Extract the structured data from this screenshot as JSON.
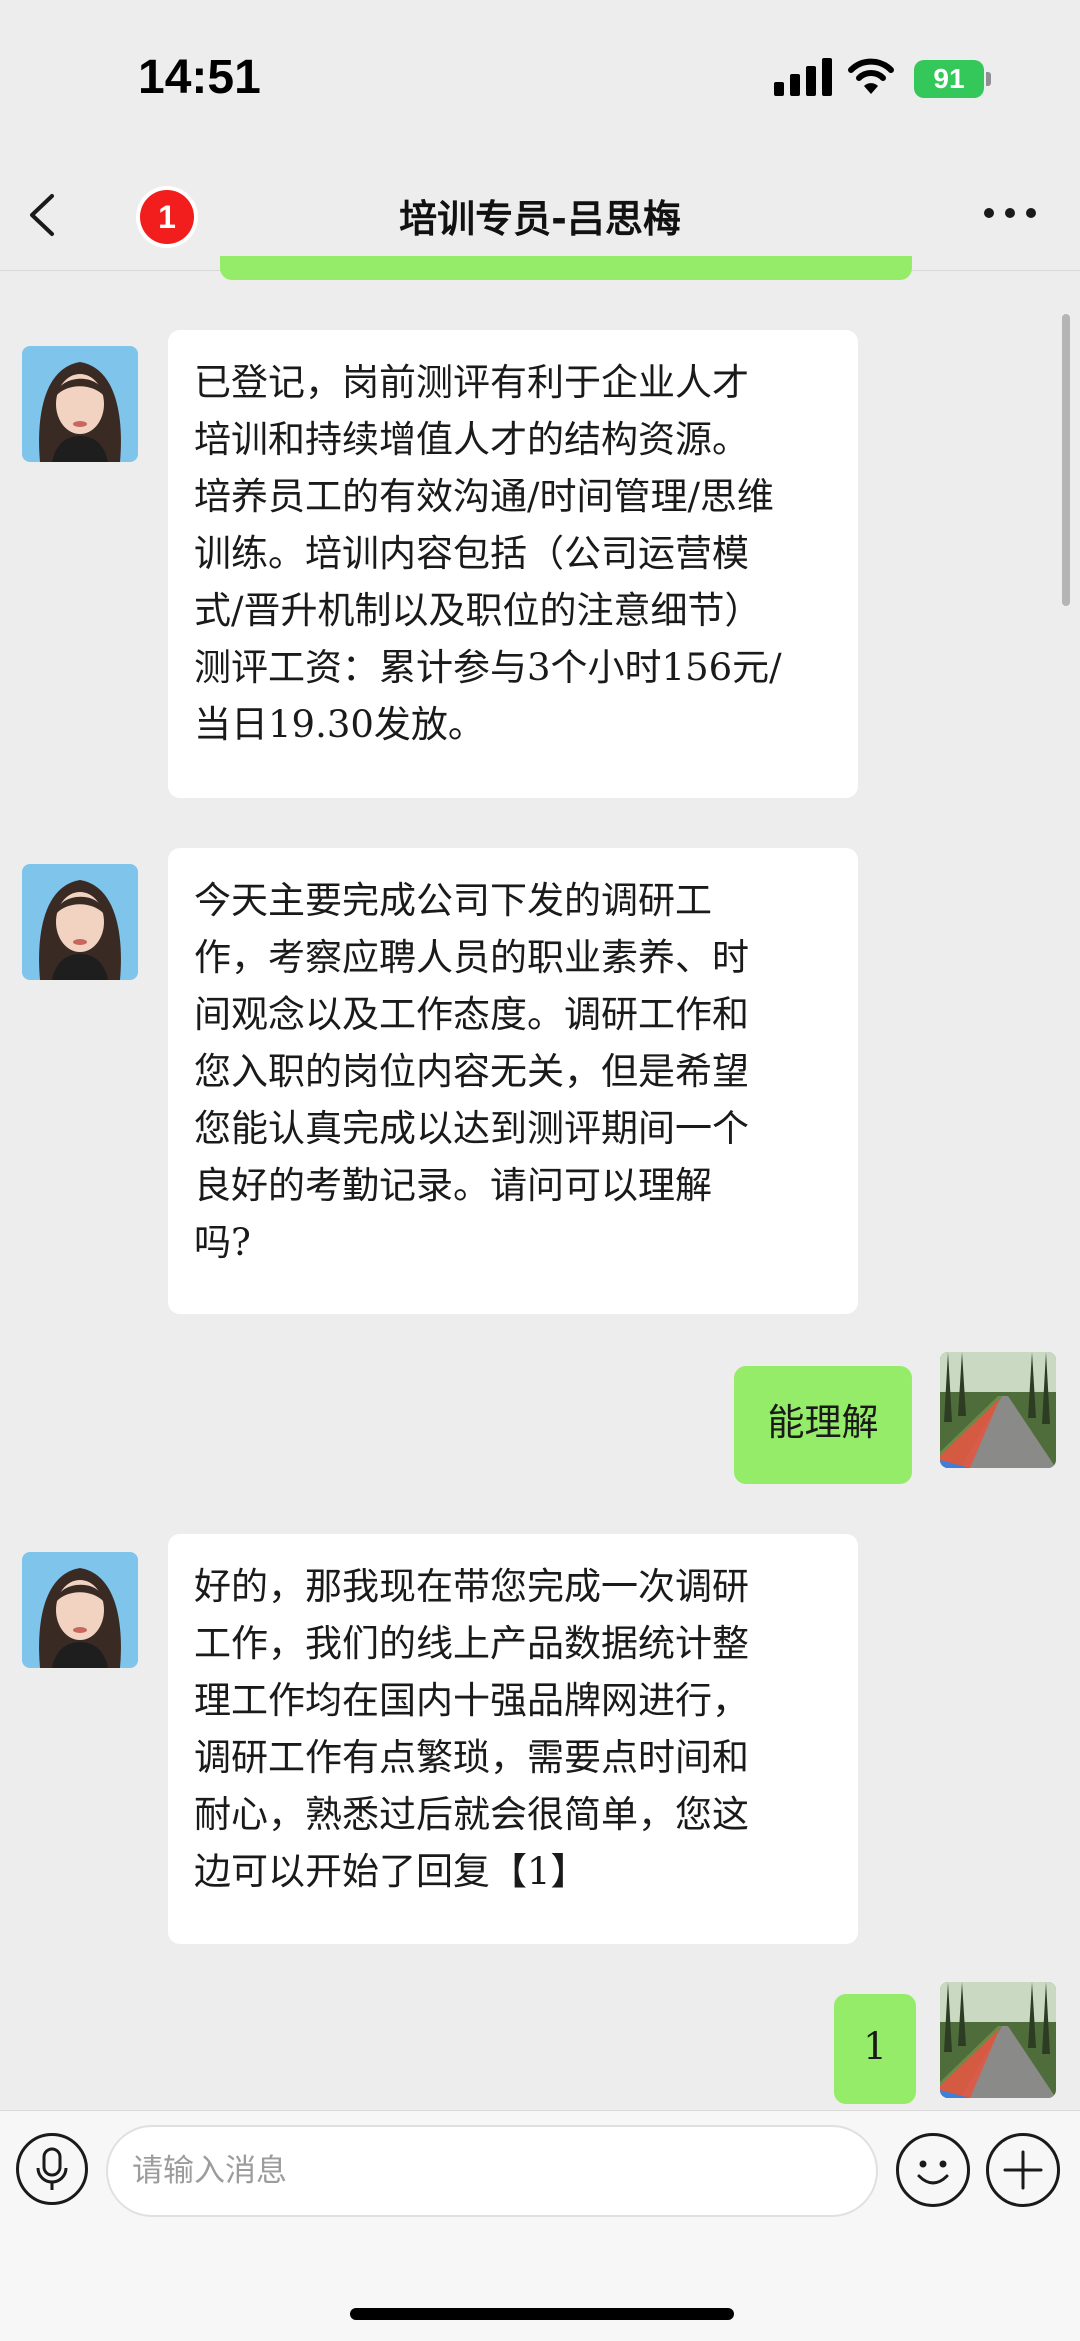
{
  "status_bar": {
    "time": "14:51",
    "battery": "91"
  },
  "nav": {
    "unread_count": "1",
    "title": "培训专员-吕思梅"
  },
  "messages": [
    {
      "side": "in",
      "text": "已登记，岗前测评有利于企业人才\n培训和持续增值人才的结构资源。\n培养员工的有效沟通/时间管理/思维\n训练。培训内容包括（公司运营模\n式/晋升机制以及职位的注意细节）\n测评工资：累计参与3个小时156元/\n当日19.30发放。"
    },
    {
      "side": "in",
      "text": "今天主要完成公司下发的调研工\n作，考察应聘人员的职业素养、时\n间观念以及工作态度。调研工作和\n您入职的岗位内容无关，但是希望\n您能认真完成以达到测评期间一个\n良好的考勤记录。请问可以理解\n吗?"
    },
    {
      "side": "out",
      "text": "能理解"
    },
    {
      "side": "in",
      "text": "好的，那我现在带您完成一次调研\n工作，我们的线上产品数据统计整\n理工作均在国内十强品牌网进行，\n调研工作有点繁琐，需要点时间和\n耐心，熟悉过后就会很简单，您这\n边可以开始了回复【1】"
    },
    {
      "side": "out",
      "text": "1"
    }
  ],
  "input": {
    "placeholder": "请输入消息",
    "value": ""
  },
  "icons": {
    "back": "chevron-left-icon",
    "more": "more-dots-icon",
    "voice": "microphone-icon",
    "emoji": "smiley-icon",
    "plus": "plus-icon"
  },
  "colors": {
    "outgoing_bubble": "#95ec69",
    "incoming_bubble": "#ffffff",
    "badge": "#f21d1d",
    "battery": "#34c759",
    "background": "#ededed"
  }
}
